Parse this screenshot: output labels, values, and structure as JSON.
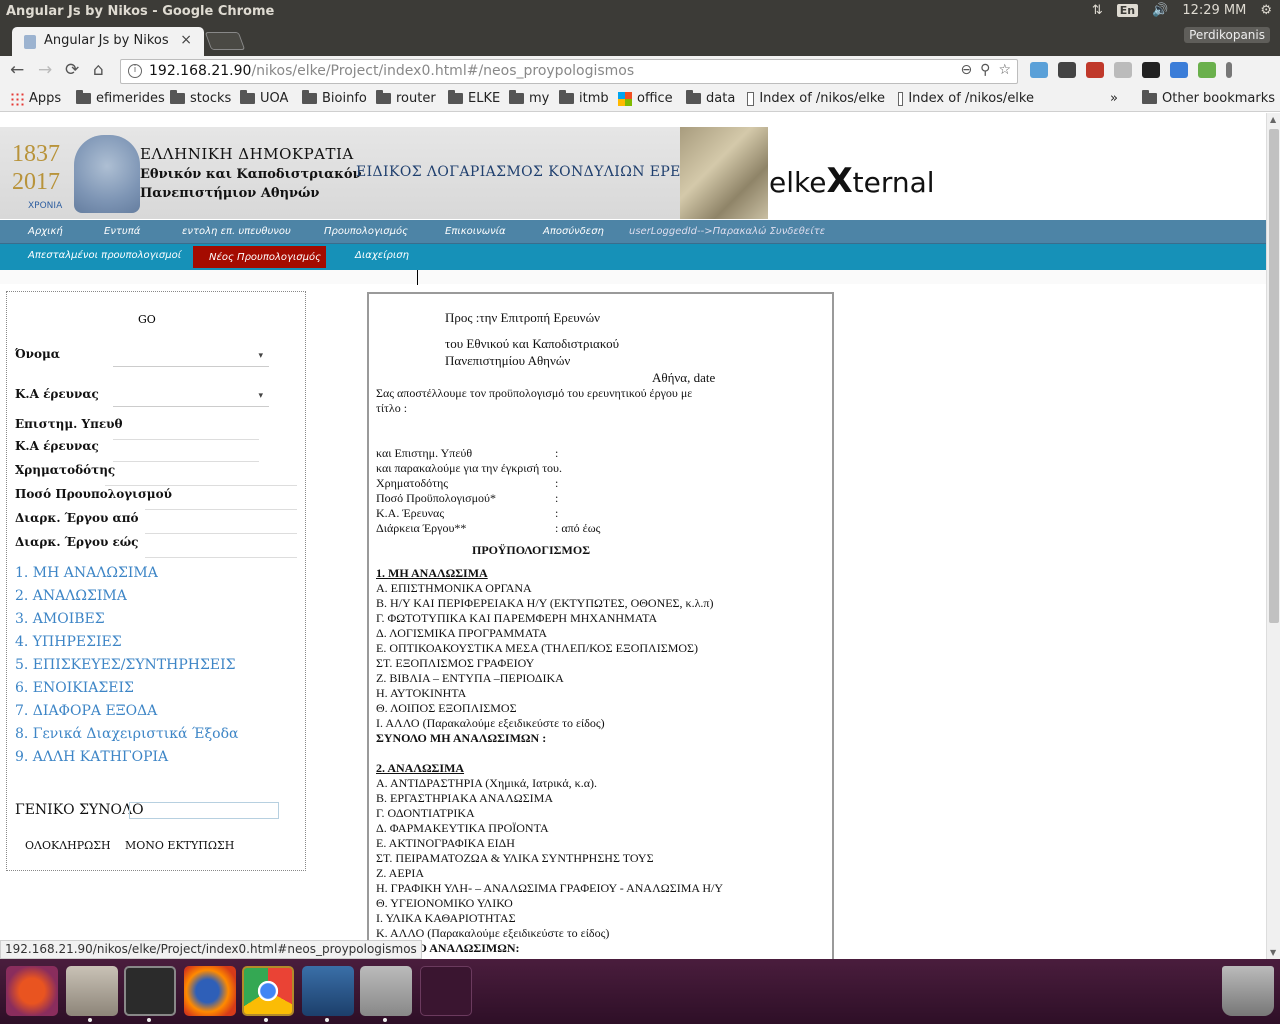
{
  "os": {
    "window_title": "Angular Js by Nikos - Google Chrome",
    "lang": "En",
    "clock": "12:29 MM"
  },
  "chrome": {
    "tab_title": "Angular Js by Nikos",
    "tab_close": "×",
    "profile": "Perdikopanis",
    "url_host": "192.168.21.90",
    "url_path": "/nikos/elke/Project/index0.html#/neos_proypologismos",
    "status_url": "192.168.21.90/nikos/elke/Project/index0.html#neos_proypologismos",
    "nav": {
      "back": "←",
      "forward": "→",
      "reload": "⟳",
      "home": "⌂"
    },
    "bookmarks": [
      {
        "label": "Apps",
        "type": "apps"
      },
      {
        "label": "efimerides",
        "type": "folder"
      },
      {
        "label": "stocks",
        "type": "folder"
      },
      {
        "label": "UOA",
        "type": "folder"
      },
      {
        "label": "Bioinfo",
        "type": "folder"
      },
      {
        "label": "router",
        "type": "folder"
      },
      {
        "label": "ELKE",
        "type": "folder"
      },
      {
        "label": "my",
        "type": "folder"
      },
      {
        "label": "itmb",
        "type": "folder"
      },
      {
        "label": "office",
        "type": "ms-icon"
      },
      {
        "label": "data",
        "type": "folder"
      },
      {
        "label": "Index of /nikos/elke",
        "type": "page"
      },
      {
        "label": "Index of /nikos/elke",
        "type": "page"
      }
    ],
    "bookmarks_more": "»",
    "other_bookmarks": "Other bookmarks"
  },
  "banner": {
    "year_top": "1837",
    "year_bottom": "2017",
    "xronia": "ΧΡΟΝΙΑ",
    "line1": "ΕΛΛΗΝΙΚΗ ΔΗΜΟΚΡΑΤΙΑ",
    "line2": "Εθνικόν και Καποδιστριακόν",
    "line3": "Πανεπιστήμιον Αθηνών",
    "special": "ΕΙΔΙΚΟΣ ΛΟΓΑΡΙΑΣΜΟΣ ΚΟΝΔΥΛΙΩΝ ΕΡΕΥΝΑΣ",
    "title_pre": "elke",
    "title_x": "X",
    "title_post": "ternal"
  },
  "nav1": [
    "Αρχική",
    "Εντυπά",
    "εντολη επ. υπευθυνου",
    "Προυπολογισμός",
    "Επικοινωνία",
    "Αποσύνδεση",
    "userLoggedId-->Παρακαλώ Συνδεθείτε"
  ],
  "nav2": [
    "Απεσταλμένοι προυπολογισμοί",
    "Νέος Προυπολογισμός",
    "Διαχείριση"
  ],
  "form": {
    "go": "GO",
    "onoma": "Όνομα",
    "ka_ereunas": "Κ.Α έρευνας",
    "epist_ypeuth": "Επιστημ. Υπευθ",
    "ka_ereunas2": "Κ.Α έρευνας",
    "xrimatodotis": "Χρηματοδότης",
    "poso": "Ποσό Προυπολογισμού",
    "diark_apo": "Διαρκ. Έργου από",
    "diark_eos": "Διαρκ. Έργου εώς",
    "dropdown_arrow": "▾",
    "categories": [
      "1. ΜΗ ΑΝΑΛΩΣΙΜΑ",
      "2. ΑΝΑΛΩΣΙΜΑ",
      "3. ΑΜΟΙΒΕΣ",
      "4. ΥΠΗΡΕΣΙΕΣ",
      "5. ΕΠΙΣΚΕΥΕΣ/ΣΥΝΤΗΡΗΣΕΙΣ",
      "6. ΕΝΟΙΚΙΑΣΕΙΣ",
      "7. ΔΙΑΦΟΡΑ ΕΞΟΔΑ",
      "8. Γενικά Διαχειριστικά Έξοδα",
      "9. ΑΛΛΗ ΚΑΤΗΓΟΡΙΑ"
    ],
    "total_label": "ΓΕΝΙΚΟ ΣΥΝΟΛΟ",
    "btn_complete": "ΟΛΟΚΛΗΡΩΣΗ",
    "btn_print": "ΜΟΝΟ ΕΚΤΥΠΩΣΗ"
  },
  "doc": {
    "pros": "Προς :την Επιτροπή Ερευνών",
    "tou": "του Εθνικού και Καποδιστριακού",
    "panep": "Πανεπιστημίου Αθηνών",
    "athina": "Αθήνα, date",
    "intro1": "Σας αποστέλλουμε τον προϋπολογισμό του ερευνητικού έργου με",
    "intro2": "τίτλο :",
    "r1_label": "και Επιστημ. Υπεύθ",
    "colon": ":",
    "r2_label": "και παρακαλούμε για την έγκρισή του.",
    "r3_label": "Χρηματοδότης",
    "r4_label": "Ποσό Προϋπολογισμού*",
    "r5_label": "Κ.Α. Έρευνας",
    "r6_label": "Διάρκεια Έργου**",
    "r6_value": ": από έως",
    "heading": "ΠΡΟΫΠΟΛΟΓΙΣΜΟΣ",
    "sec1_title": "1. ΜΗ ΑΝΑΛΩΣΙΜΑ",
    "sec1_items": [
      "Α. ΕΠΙΣΤΗΜΟΝΙΚΑ ΟΡΓΑΝΑ",
      "Β. Η/Υ ΚΑΙ ΠΕΡΙΦΕΡΕΙΑΚΑ Η/Υ (ΕΚΤΥΠΩΤΕΣ, ΟΘΟΝΕΣ, κ.λ.π)",
      "Γ. ΦΩΤΟΤΥΠΙΚΑ ΚΑΙ ΠΑΡΕΜΦΕΡΗ ΜΗΧΑΝΗΜΑΤΑ",
      "Δ. ΛΟΓΙΣΜΙΚΑ ΠΡΟΓΡΑΜΜΑΤΑ",
      "Ε. ΟΠΤΙΚΟΑΚΟΥΣΤΙΚΑ ΜΕΣΑ (ΤΗΛΕΠ/ΚΟΣ ΕΞΟΠΛΙΣΜΟΣ)",
      "ΣΤ. ΕΞΟΠΛΙΣΜΟΣ ΓΡΑΦΕΙΟΥ",
      "Ζ. ΒΙΒΛΙΑ – ΕΝΤΥΠΑ –ΠΕΡΙΟΔΙΚΑ",
      "Η. ΑΥΤΟΚΙΝΗΤΑ",
      "Θ. ΛΟΙΠΟΣ ΕΞΟΠΛΙΣΜΟΣ",
      "Ι. ΑΛΛΟ (Παρακαλούμε εξειδικεύστε το είδος)"
    ],
    "sec1_total": "ΣΥΝΟΛΟ ΜΗ ΑΝΑΛΩΣΙΜΩΝ :",
    "sec2_title": "2. ΑΝΑΛΩΣΙΜΑ",
    "sec2_items": [
      "Α. ΑΝΤΙΔΡΑΣΤΗΡΙΑ (Χημικά, Ιατρικά, κ.α).",
      "Β. ΕΡΓΑΣΤΗΡΙΑΚΑ ΑΝΑΛΩΣΙΜΑ",
      "Γ. ΟΔΟΝΤΙΑΤΡΙΚΑ",
      "Δ. ΦΑΡΜΑΚΕΥΤΙΚΑ ΠΡΟΪΟΝΤΑ",
      "Ε. ΑΚΤΙΝΟΓΡΑΦΙΚΑ ΕΙΔΗ",
      "ΣΤ. ΠΕΙΡΑΜΑΤΟΖΩΑ & ΥΛΙΚΑ ΣΥΝΤΗΡΗΣΗΣ ΤΟΥΣ",
      "Ζ. ΑΕΡΙΑ",
      "Η. ΓΡΑΦΙΚΗ ΥΛΗ- – ΑΝΑΛΩΣΙΜΑ ΓΡΑΦΕΙΟΥ - ΑΝΑΛΩΣΙΜΑ Η/Υ",
      "Θ. ΥΓΕΙΟΝΟΜΙΚΟ ΥΛΙΚΟ",
      "Ι. ΥΛΙΚΑ ΚΑΘΑΡΙΟΤΗΤΑΣ",
      "Κ. ΑΛΛΟ (Παρακαλούμε εξειδικεύστε το είδος)"
    ],
    "sec2_total": "ΣΥΝΟΛΟ ΑΝΑΛΩΣΙΜΩΝ:"
  },
  "colors": {
    "nav1_bg": "#4d84a6",
    "nav2_bg": "#1691b8",
    "active_tab": "#a40b00",
    "category_link": "#3d85c6"
  }
}
